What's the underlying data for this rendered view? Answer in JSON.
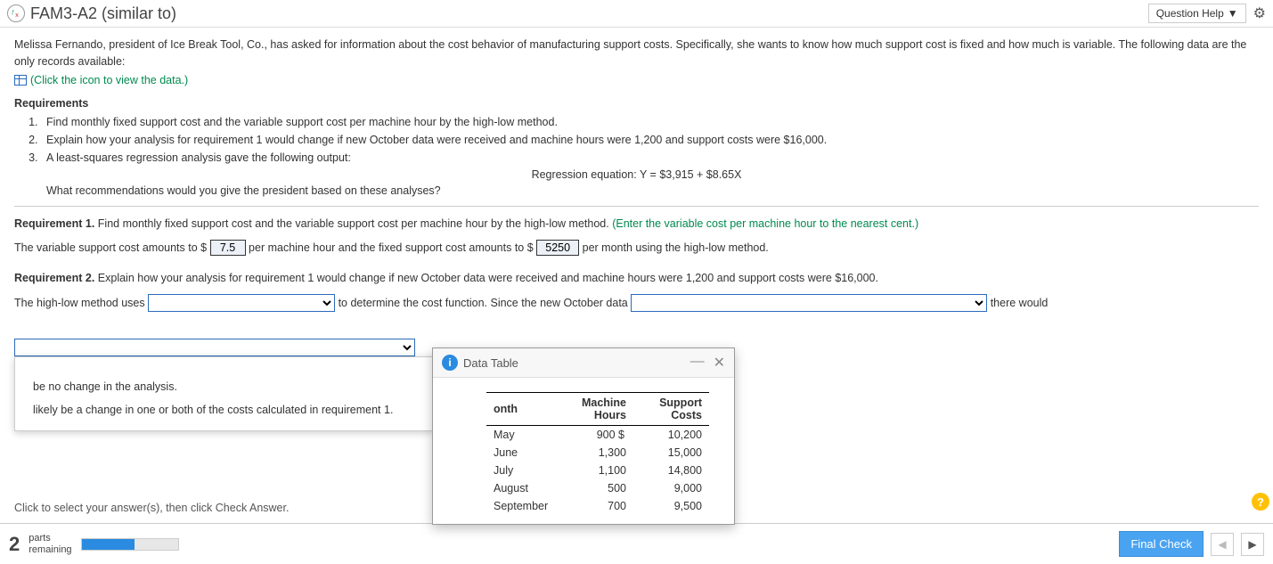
{
  "header": {
    "title": "FAM3-A2 (similar to)",
    "question_help": "Question Help"
  },
  "intro": {
    "p1": "Melissa Fernando, president of Ice Break Tool, Co., has asked for information about the cost behavior of manufacturing support costs. Specifically, she wants to know how much support cost is fixed and how much is variable. The following data are the only records available:",
    "data_link": "(Click the icon to view the data.)"
  },
  "requirements": {
    "heading": "Requirements",
    "items": [
      "Find monthly fixed support cost and the variable support cost per machine hour by the high-low method.",
      "Explain how your analysis for requirement 1 would change if new October data were received and machine hours were 1,200 and support costs were $16,000.",
      "A least-squares regression analysis gave the following output:"
    ],
    "regression": "Regression equation: Y = $3,915 + $8.65X",
    "followup": "What recommendations would you give the president based on these analyses?"
  },
  "answers": {
    "r1_label": "Requirement 1.",
    "r1_text": " Find monthly fixed support cost and the variable support cost per machine hour by the high-low method. ",
    "r1_hint": "(Enter the variable cost per machine hour to the nearest cent.)",
    "r1_sentence_a": "The variable support cost amounts to $ ",
    "r1_val1": "7.5",
    "r1_sentence_b": " per machine hour and the fixed support cost amounts to $ ",
    "r1_val2": "5250",
    "r1_sentence_c": " per month using the high-low method.",
    "r2_label": "Requirement 2.",
    "r2_text": " Explain how your analysis for requirement 1 would change if new October data were received and machine hours were 1,200 and support costs were $16,000.",
    "r2_sentence_a": "The high-low method uses ",
    "r2_sentence_b": " to determine the cost function. Since the new October data ",
    "r2_sentence_c": " there would"
  },
  "dropdown_options": [
    "be no change in the analysis.",
    "likely be a change in one or both of the costs calculated in requirement 1."
  ],
  "data_popup": {
    "title": "Data Table",
    "cols": [
      "onth",
      "Machine Hours",
      "Support Costs"
    ],
    "rows": [
      {
        "month": "May",
        "mh": "900",
        "dollar": "$",
        "sc": "10,200"
      },
      {
        "month": "June",
        "mh": "1,300",
        "dollar": "",
        "sc": "15,000"
      },
      {
        "month": "July",
        "mh": "1,100",
        "dollar": "",
        "sc": "14,800"
      },
      {
        "month": "August",
        "mh": "500",
        "dollar": "",
        "sc": "9,000"
      },
      {
        "month": "September",
        "mh": "700",
        "dollar": "",
        "sc": "9,500"
      }
    ]
  },
  "chart_data": {
    "type": "table",
    "title": "Data Table",
    "columns": [
      "Month",
      "Machine Hours",
      "Support Costs"
    ],
    "rows": [
      [
        "May",
        900,
        10200
      ],
      [
        "June",
        1300,
        15000
      ],
      [
        "July",
        1100,
        14800
      ],
      [
        "August",
        500,
        9000
      ],
      [
        "September",
        700,
        9500
      ]
    ]
  },
  "footer": {
    "hint": "Click to select your answer(s), then click Check Answer.",
    "parts_num": "2",
    "parts_label_a": "parts",
    "parts_label_b": "remaining",
    "final": "Final Check"
  }
}
